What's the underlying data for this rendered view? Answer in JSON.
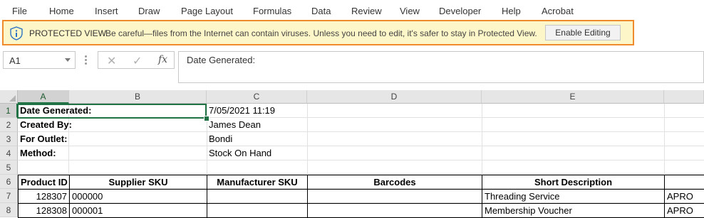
{
  "ribbon": {
    "tabs": [
      "File",
      "Home",
      "Insert",
      "Draw",
      "Page Layout",
      "Formulas",
      "Data",
      "Review",
      "View",
      "Developer",
      "Help",
      "Acrobat"
    ]
  },
  "protected_view": {
    "title": "PROTECTED VIEW",
    "message": "Be careful—files from the Internet can contain viruses. Unless you need to edit, it's safer to stay in Protected View.",
    "button": "Enable Editing",
    "border_color": "#ef8b2c",
    "bg_color": "#fdf6c8"
  },
  "formula_bar": {
    "name_box": "A1",
    "cancel_icon": "✕",
    "enter_icon": "✓",
    "fx_label": "fx",
    "formula": "Date Generated:"
  },
  "grid": {
    "columns": [
      "A",
      "B",
      "C",
      "D",
      "E"
    ],
    "rows": [
      "1",
      "2",
      "3",
      "4",
      "5",
      "6",
      "7",
      "8"
    ],
    "cells": {
      "A1": "Date Generated:",
      "C1": "7/05/2021 11:19",
      "A2": "Created By:",
      "C2": "James Dean",
      "A3": "For Outlet:",
      "C3": "Bondi",
      "A4": "Method:",
      "C4": "Stock On Hand",
      "A6": "Product ID",
      "B6": "Supplier SKU",
      "C6": "Manufacturer SKU",
      "D6": "Barcodes",
      "E6": "Short Description",
      "A7": "128307",
      "B7": "000000",
      "E7": "Threading Service",
      "F7": "APRO",
      "A8": "128308",
      "B8": "000001",
      "E8": "Membership Voucher",
      "F8": "APRO"
    }
  },
  "accent_color": "#217346"
}
